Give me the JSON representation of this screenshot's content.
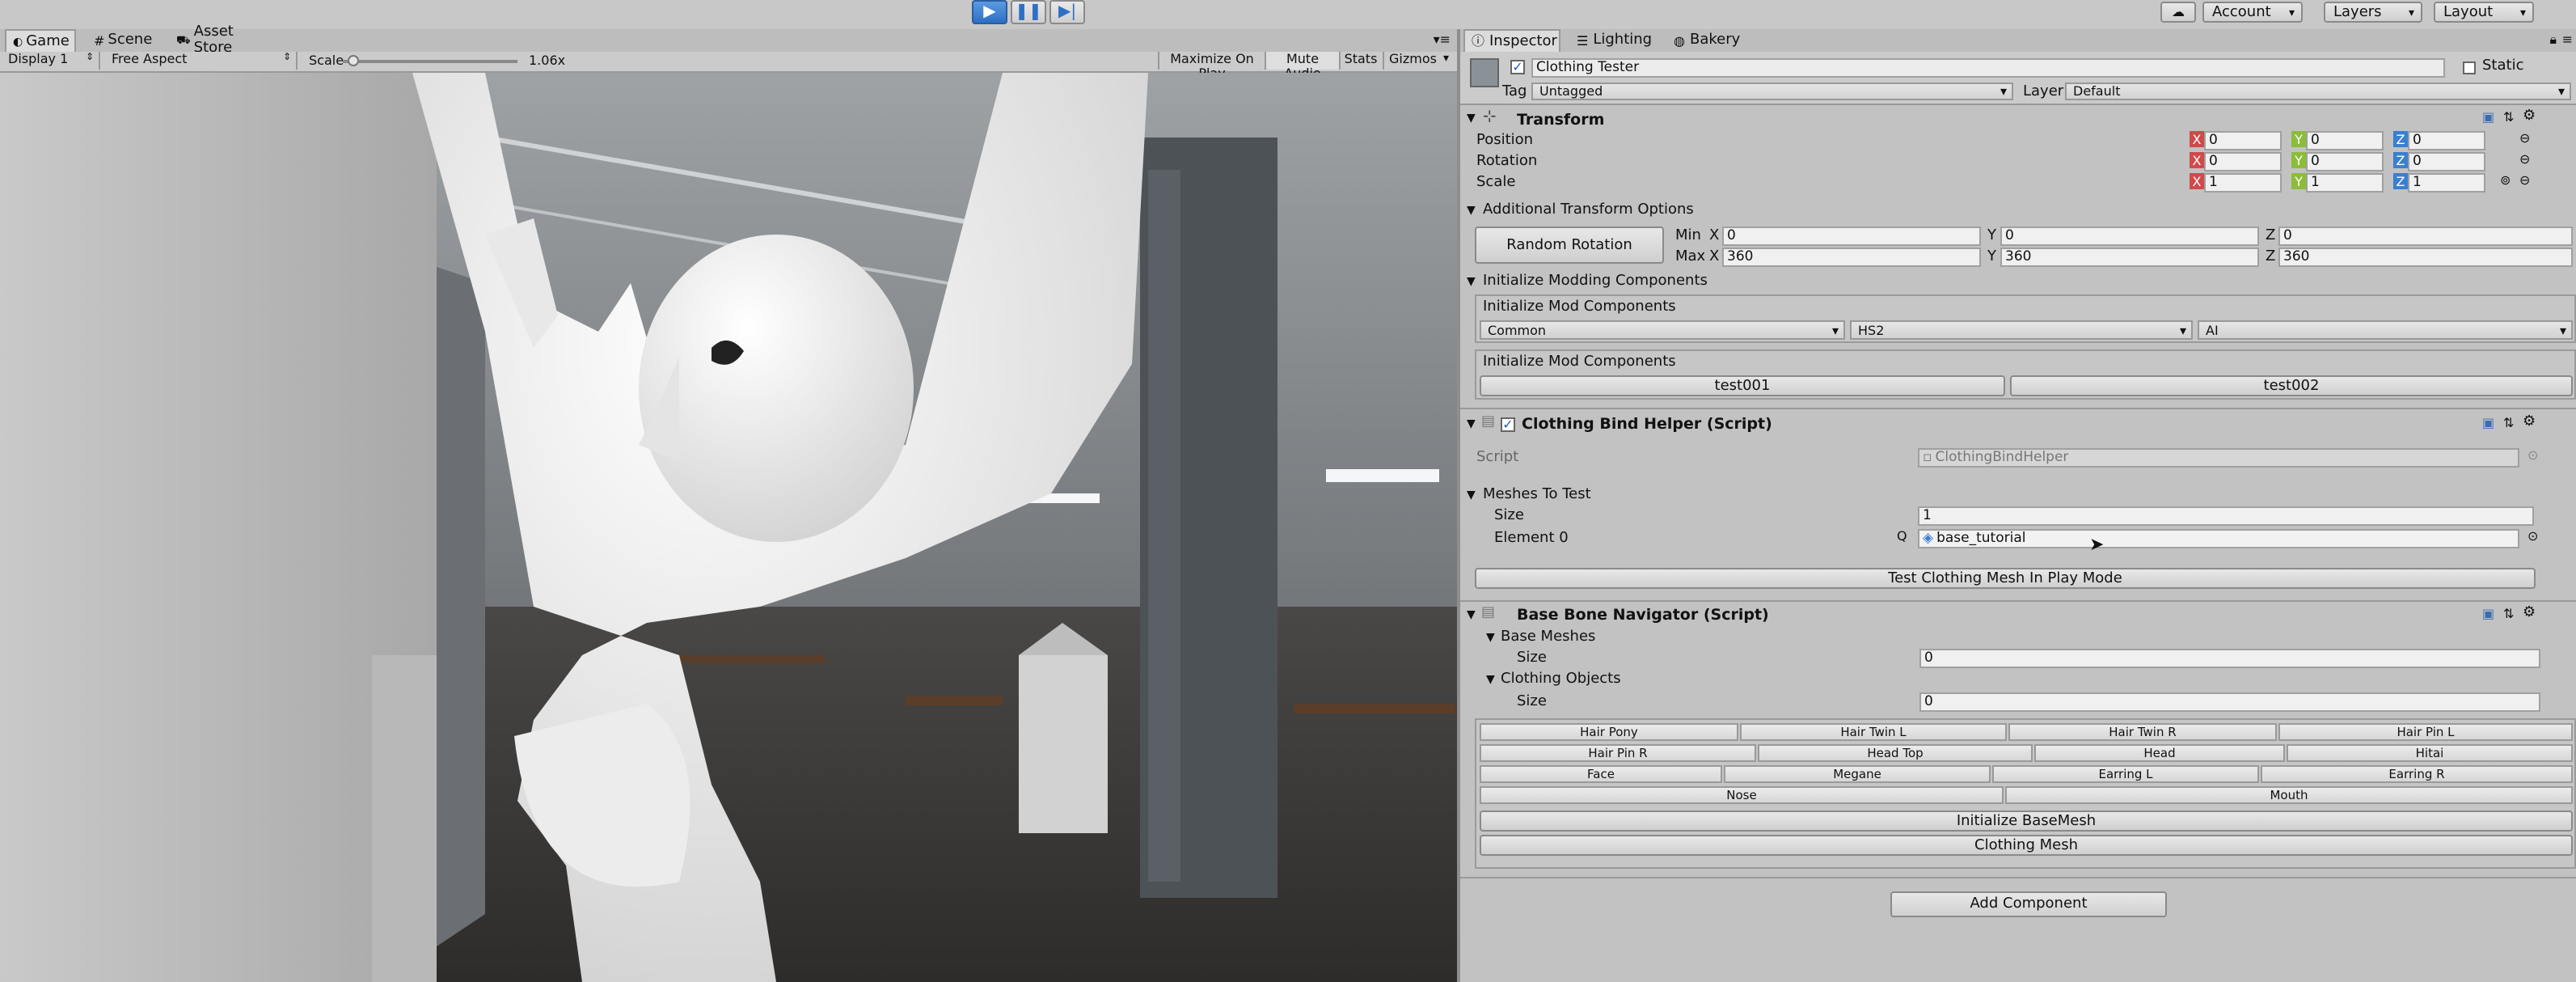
{
  "toolbar": {
    "play_icon": "play-icon",
    "pause_icon": "pause-icon",
    "step_icon": "step-icon",
    "account": "Account",
    "layers": "Layers",
    "layout": "Layout"
  },
  "game_tabs": {
    "game": "Game",
    "scene": "Scene",
    "asset_store": "Asset Store"
  },
  "game_bar": {
    "display": "Display 1",
    "aspect": "Free Aspect",
    "scale_label": "Scale",
    "scale_value": "1.06x",
    "scale_fraction": 0.06,
    "maximize": "Maximize On Play",
    "mute": "Mute Audio",
    "stats": "Stats",
    "gizmos": "Gizmos"
  },
  "inspector_tabs": {
    "inspector": "Inspector",
    "lighting": "Lighting",
    "bakery": "Bakery"
  },
  "object": {
    "name": "Clothing Tester",
    "static": "Static",
    "tag_label": "Tag",
    "tag": "Untagged",
    "layer_label": "Layer",
    "layer": "Default"
  },
  "transform": {
    "title": "Transform",
    "position_label": "Position",
    "rotation_label": "Rotation",
    "scale_label": "Scale",
    "x": "X",
    "y": "Y",
    "z": "Z",
    "position": [
      "0",
      "0",
      "0"
    ],
    "rotation": [
      "0",
      "0",
      "0"
    ],
    "scale": [
      "1",
      "1",
      "1"
    ]
  },
  "additional": {
    "title": "Additional Transform Options",
    "random_rotation": "Random Rotation",
    "min_label": "Min",
    "max_label": "Max",
    "min": [
      "0",
      "0",
      "0"
    ],
    "max": [
      "360",
      "360",
      "360"
    ]
  },
  "modding": {
    "title": "Initialize Modding Components",
    "box1_title": "Initialize Mod Components",
    "dropdowns": [
      "Common",
      "HS2",
      "AI"
    ],
    "box2_title": "Initialize Mod Components",
    "buttons": [
      "test001",
      "test002"
    ]
  },
  "bind_helper": {
    "title": "Clothing Bind Helper (Script)",
    "script_label": "Script",
    "script_value": "ClothingBindHelper",
    "meshes_label": "Meshes To Test",
    "size_label": "Size",
    "size_value": "1",
    "element_label": "Element 0",
    "element_value": "base_tutorial",
    "test_button": "Test Clothing Mesh In Play Mode"
  },
  "bone_nav": {
    "title": "Base Bone Navigator (Script)",
    "base_meshes": "Base Meshes",
    "size_label": "Size",
    "base_size": "0",
    "clothing_objects": "Clothing Objects",
    "clothing_size": "0",
    "row1": [
      "Hair Pony",
      "Hair Twin L",
      "Hair Twin R",
      "Hair Pin L"
    ],
    "row2": [
      "Hair Pin R",
      "Head Top",
      "Head",
      "Hitai"
    ],
    "row3": [
      "Face",
      "Megane",
      "Earring L",
      "Earring R"
    ],
    "row4": [
      "Nose",
      "Mouth"
    ],
    "init_basemesh": "Initialize BaseMesh",
    "clothing_mesh": "Clothing Mesh"
  },
  "add_component": "Add Component",
  "colors": {
    "editor_bg": "#c2c2c2",
    "play_active": "#3c7fd1",
    "x_red": "#d04a4a",
    "y_green": "#8bbd3a",
    "z_blue": "#3a7fd0"
  }
}
